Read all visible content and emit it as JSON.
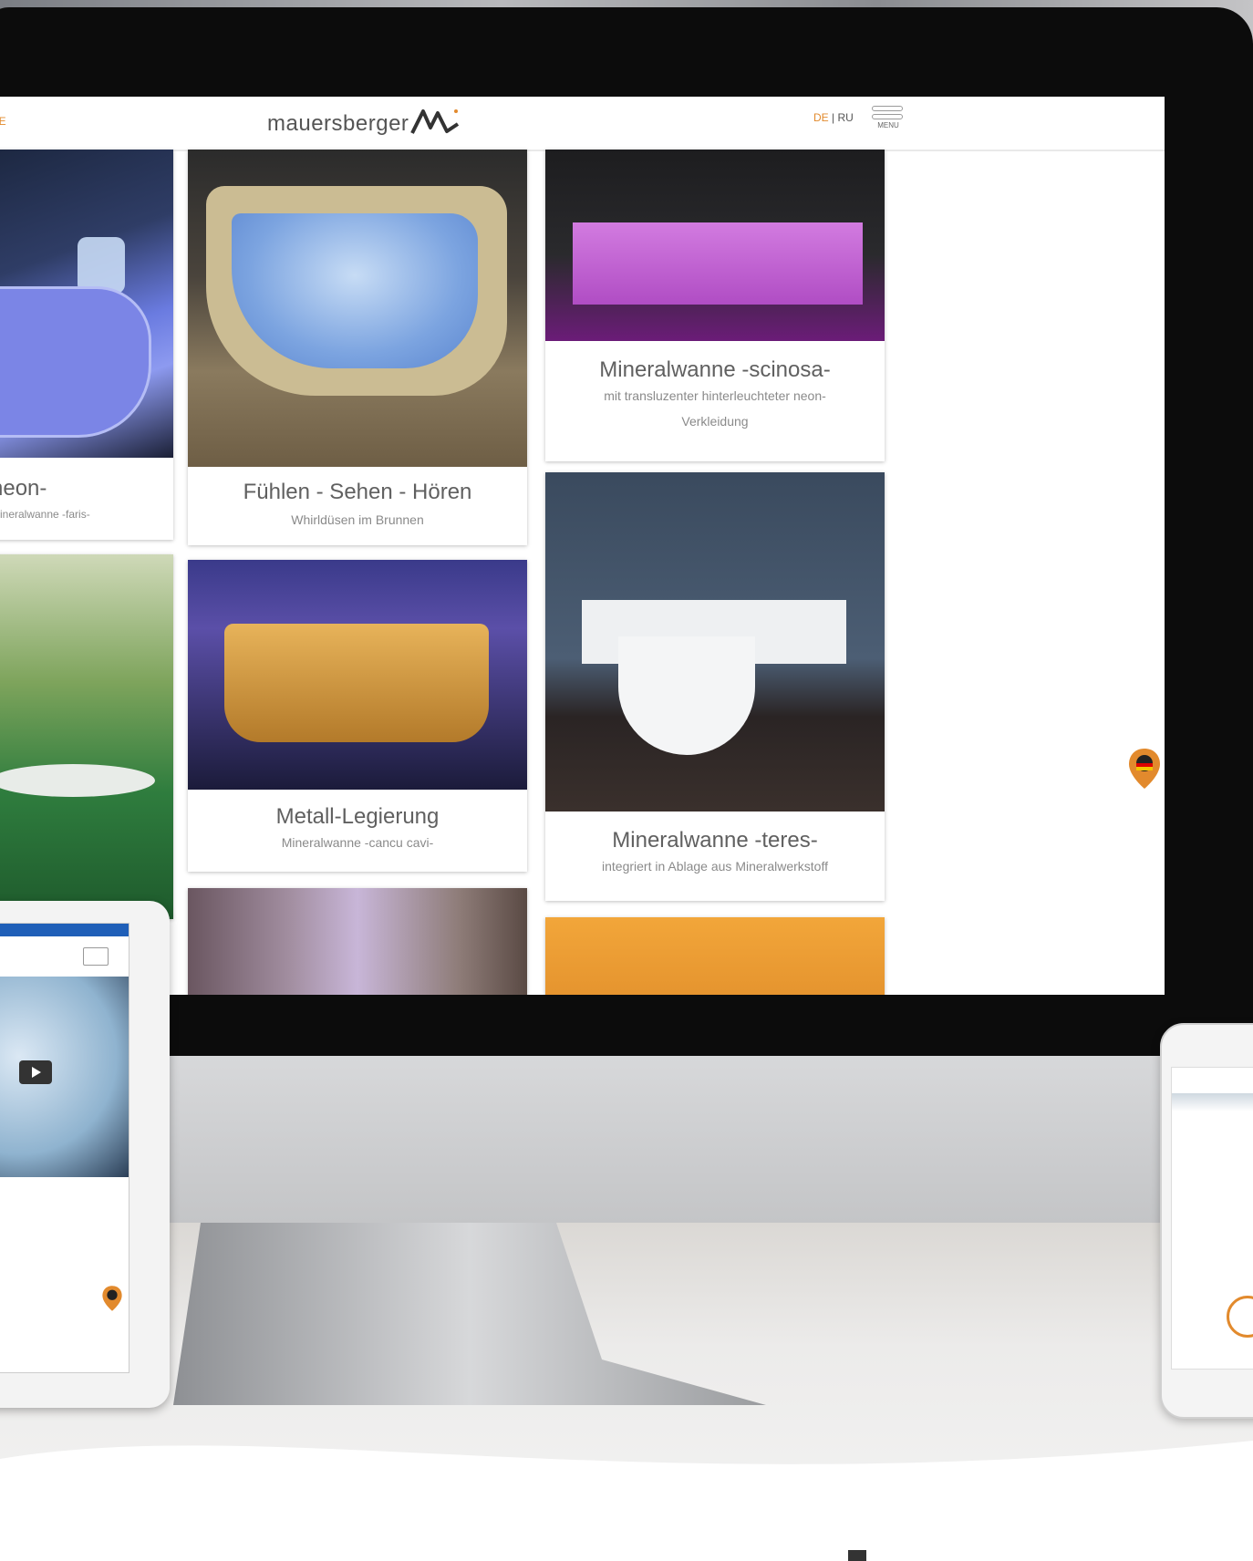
{
  "header": {
    "lang_left": "DE",
    "logo_text": "mauersberger",
    "lang_de": "DE",
    "lang_sep": "|",
    "lang_ru": "RU",
    "menu_label": "MENU"
  },
  "cards": [
    {
      "title": "neon-",
      "subtitle": "Mineralwanne -faris-"
    },
    {
      "title": "Fühlen - Sehen - Hören",
      "subtitle": "Whirldüsen im Brunnen"
    },
    {
      "title": "Mineralwanne -scinosa-",
      "subtitle": "mit transluzenter hinterleuchteter neon-Verkleidung"
    },
    {
      "title": "Metall-Legierung",
      "subtitle": "Mineralwanne -cancu cavi-"
    },
    {
      "title": "Mineralwanne -teres-",
      "subtitle": "integriert in Ablage aus Mineralwerkstoff"
    }
  ],
  "colors": {
    "accent": "#e28a2d",
    "bezel": "#0c0c0c",
    "card_text": "#606060"
  },
  "icons": [
    "location-pin-icon",
    "menu-icon",
    "play-icon",
    "logo-mark-icon"
  ]
}
